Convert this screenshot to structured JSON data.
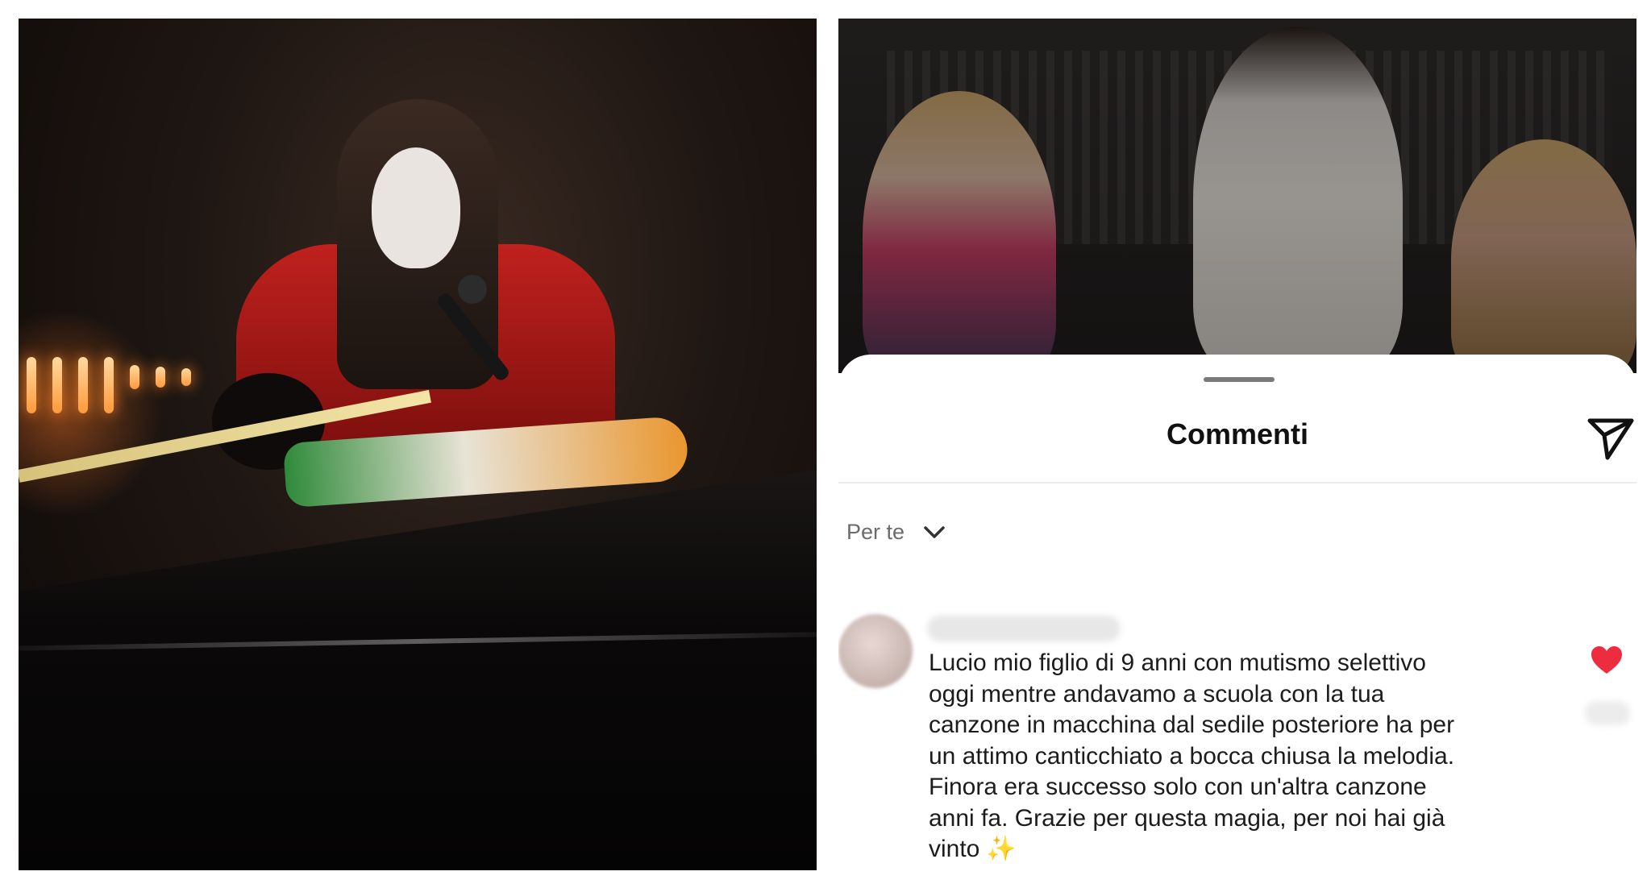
{
  "left_photo": {
    "description_icon": "stage-performance-photo"
  },
  "right_screenshot": {
    "reel_photo_icon": "market-scene-photo",
    "sheet": {
      "title": "Commenti",
      "share_icon": "send-icon",
      "sort": {
        "label": "Per te",
        "icon": "chevron-down-icon"
      },
      "comments": [
        {
          "avatar_icon": "avatar-blurred",
          "username": "",
          "text": "Lucio mio figlio di 9 anni con mutismo selettivo\noggi mentre andavamo a scuola con la tua\ncanzone in macchina dal sedile posteriore ha per\nun attimo canticchiato a bocca chiusa la melodia.\nFinora era successo solo con un'altra canzone\nanni fa. Grazie per questa magia, per noi hai già\nvinto",
          "emoji": "✨",
          "liked": true,
          "like_icon": "heart-icon",
          "heart_color": "#ed2d3f"
        }
      ]
    }
  }
}
